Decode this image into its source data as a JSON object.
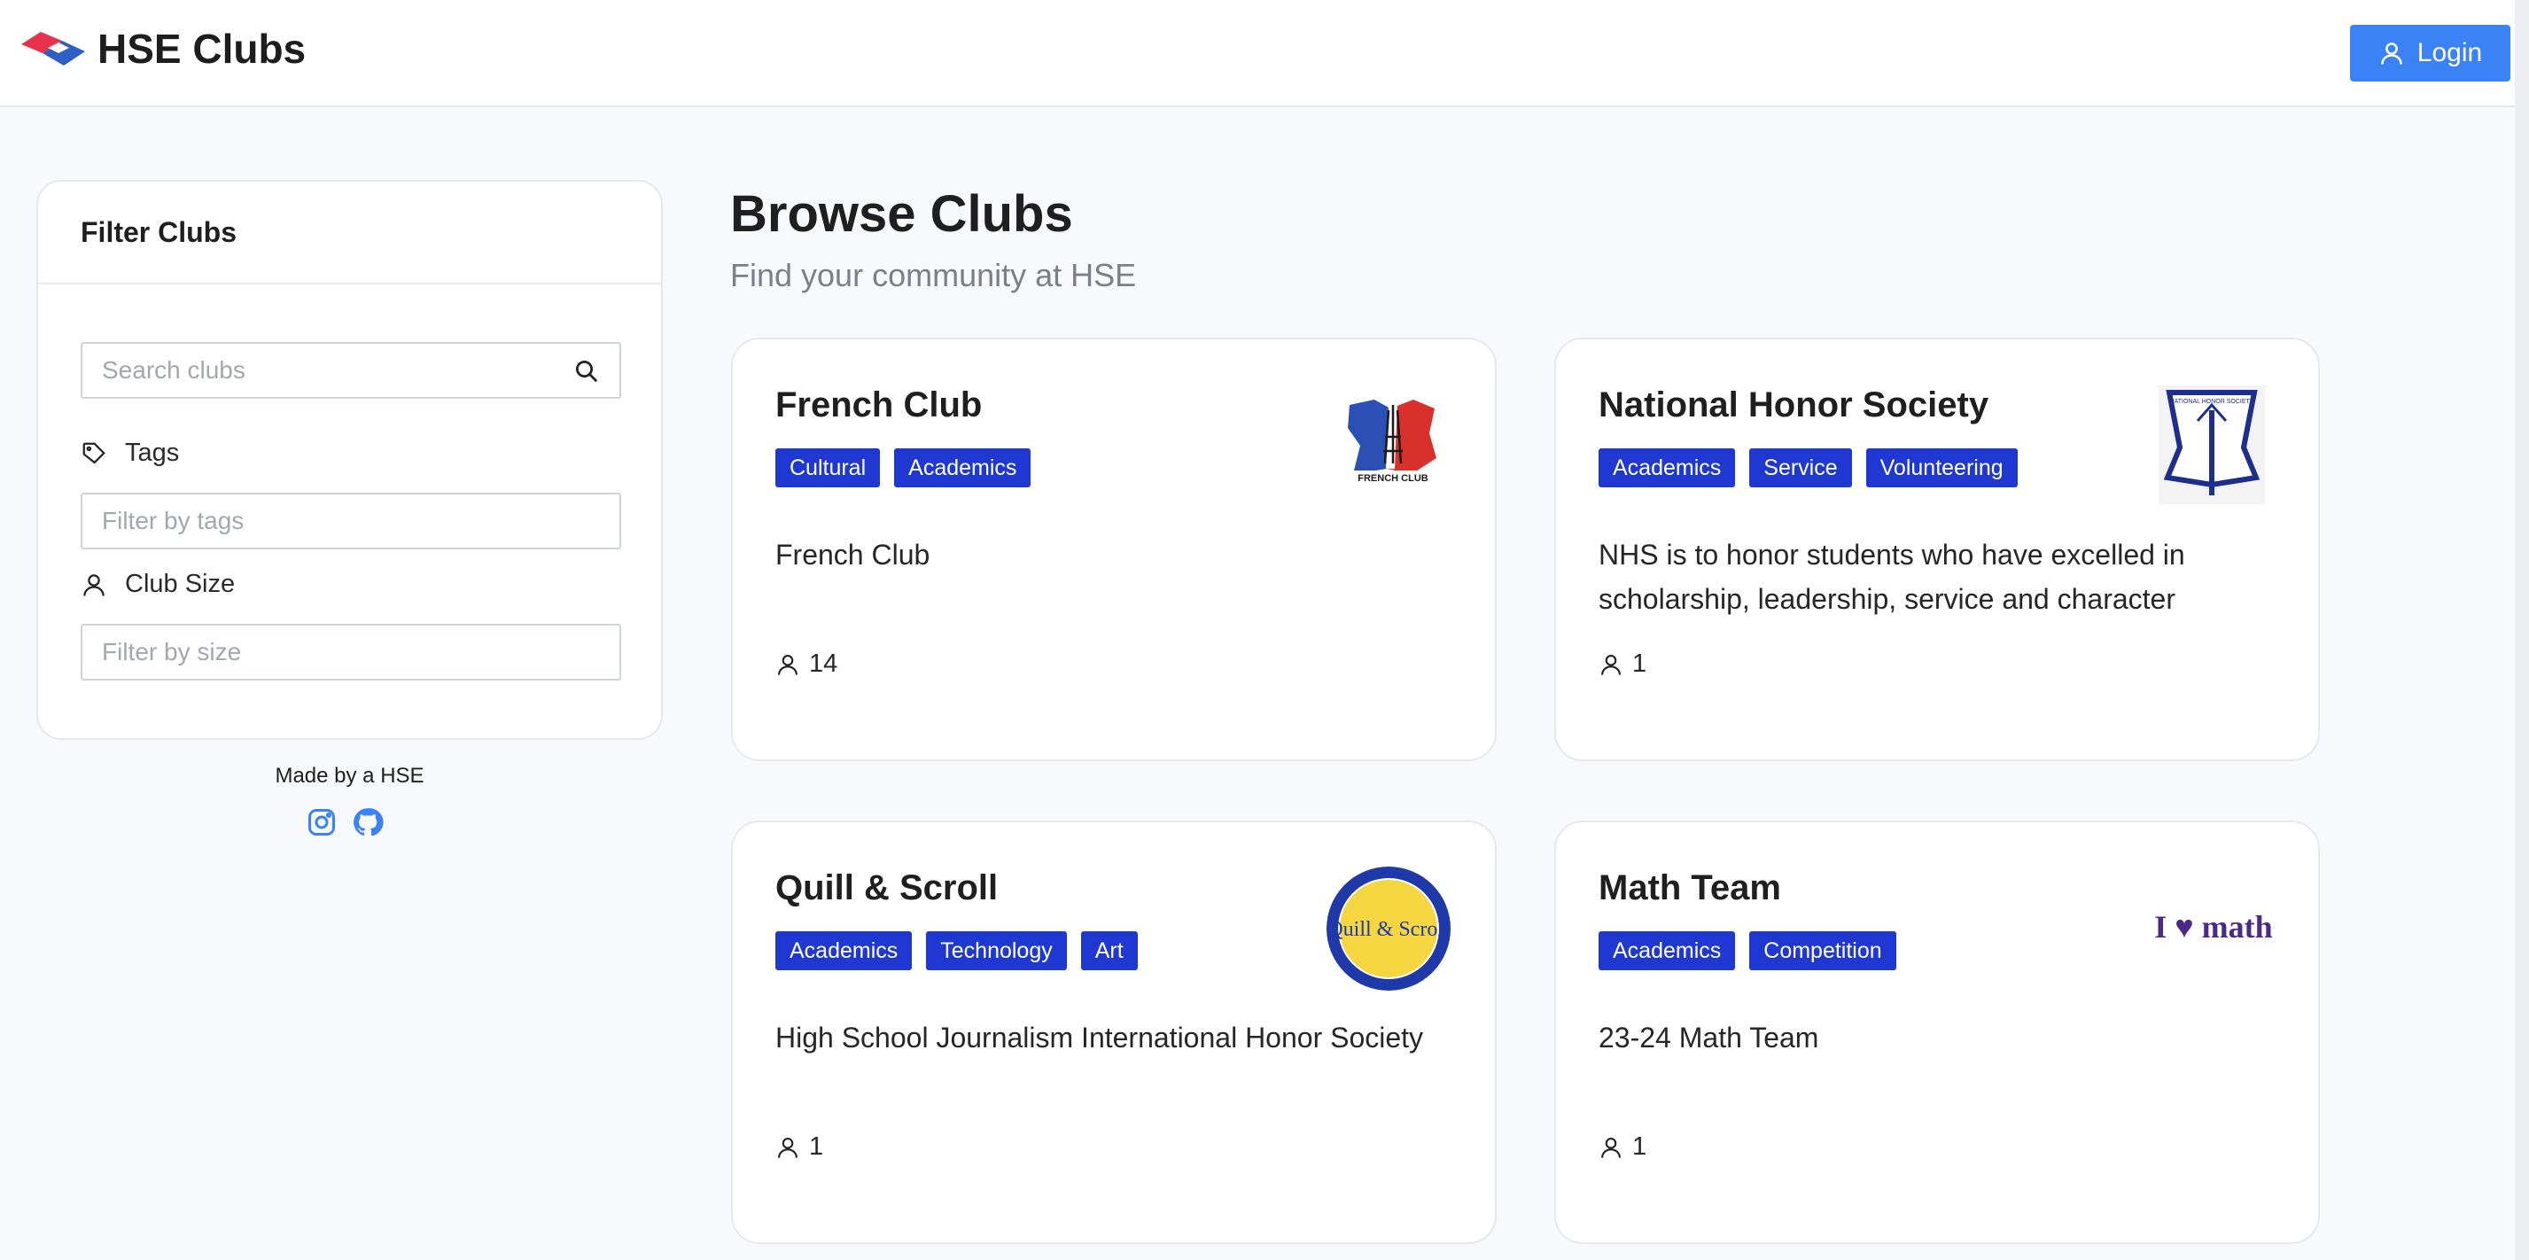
{
  "header": {
    "brand": "HSE Clubs",
    "login_label": "Login"
  },
  "sidebar": {
    "title": "Filter Clubs",
    "search_placeholder": "Search clubs",
    "tags_label": "Tags",
    "tags_placeholder": "Filter by tags",
    "size_label": "Club Size",
    "size_placeholder": "Filter by size",
    "made_by": "Made by a HSE"
  },
  "main": {
    "title": "Browse Clubs",
    "subtitle": "Find your community at HSE"
  },
  "clubs": [
    {
      "name": "French Club",
      "tags": [
        "Cultural",
        "Academics"
      ],
      "description": "French Club",
      "members": "14",
      "logo_text": "FRENCH CLUB"
    },
    {
      "name": "National Honor Society",
      "tags": [
        "Academics",
        "Service",
        "Volunteering"
      ],
      "description": "NHS is to honor students who have excelled in scholarship, leadership, service and character",
      "members": "1",
      "logo_text": "NATIONAL HONOR SOCIETY"
    },
    {
      "name": "Quill & Scroll",
      "tags": [
        "Academics",
        "Technology",
        "Art"
      ],
      "description": "High School Journalism International Honor Society",
      "members": "1",
      "logo_text": "Quill & Scroll"
    },
    {
      "name": "Math Team",
      "tags": [
        "Academics",
        "Competition"
      ],
      "description": "23-24 Math Team",
      "members": "1",
      "logo_text": "I ♥ math"
    }
  ],
  "colors": {
    "accent": "#3b82f6",
    "tag": "#1f38d1",
    "background": "#f8f9fc"
  },
  "icons": [
    "brand-logo-icon",
    "user-icon",
    "search-icon",
    "tag-icon",
    "instagram-icon",
    "github-icon"
  ]
}
